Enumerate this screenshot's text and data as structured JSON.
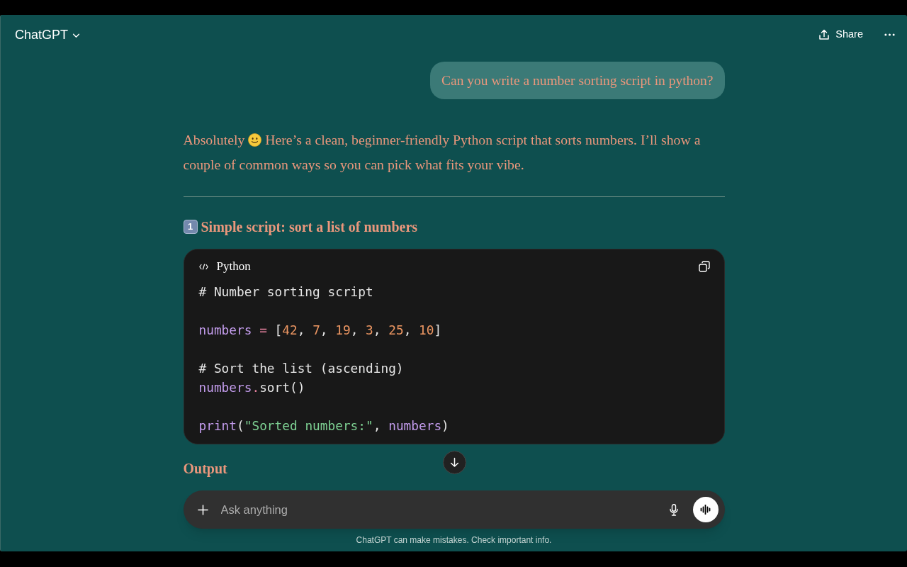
{
  "header": {
    "title": "ChatGPT",
    "share_label": "Share"
  },
  "user_message": {
    "text": "Can you write a number sorting script in python?"
  },
  "response": [
    {
      "kind": "paragraph",
      "text_before_icon": "Absolutely",
      "text_after_icon": "Here’s a clean, beginner-friendly Python script that sorts numbers. I’ll show a couple of common ways so you can pick what fits your vibe."
    },
    {
      "kind": "divider"
    },
    {
      "kind": "heading",
      "badge": "1",
      "text": "Simple script: sort a list of numbers"
    },
    {
      "kind": "code",
      "language": "Python",
      "groups": [
        [
          [
            {
              "kind": "comment",
              "text": "# Number sorting script"
            }
          ]
        ],
        [
          [
            {
              "kind": "variable",
              "text": "numbers"
            },
            {
              "kind": "operator",
              "text": " = "
            },
            {
              "kind": "plain",
              "text": "["
            },
            {
              "kind": "number",
              "text": "42"
            },
            {
              "kind": "plain",
              "text": ", "
            },
            {
              "kind": "number",
              "text": "7"
            },
            {
              "kind": "plain",
              "text": ", "
            },
            {
              "kind": "number",
              "text": "19"
            },
            {
              "kind": "plain",
              "text": ", "
            },
            {
              "kind": "number",
              "text": "3"
            },
            {
              "kind": "plain",
              "text": ", "
            },
            {
              "kind": "number",
              "text": "25"
            },
            {
              "kind": "plain",
              "text": ", "
            },
            {
              "kind": "number",
              "text": "10"
            },
            {
              "kind": "plain",
              "text": "]"
            }
          ]
        ],
        [
          [
            {
              "kind": "comment",
              "text": "# Sort the list (ascending)"
            }
          ],
          [
            {
              "kind": "variable",
              "text": "numbers"
            },
            {
              "kind": "operator",
              "text": "."
            },
            {
              "kind": "plain",
              "text": "sort()"
            }
          ]
        ],
        [
          [
            {
              "kind": "function",
              "text": "print"
            },
            {
              "kind": "plain",
              "text": "("
            },
            {
              "kind": "string",
              "text": "\"Sorted numbers:\""
            },
            {
              "kind": "plain",
              "text": ", "
            },
            {
              "kind": "variable",
              "text": "numbers"
            },
            {
              "kind": "plain",
              "text": ")"
            }
          ]
        ]
      ]
    },
    {
      "kind": "heading",
      "text": "Output"
    }
  ],
  "composer": {
    "placeholder": "Ask anything"
  },
  "disclaimer": "ChatGPT can make mistakes. Check important info."
}
